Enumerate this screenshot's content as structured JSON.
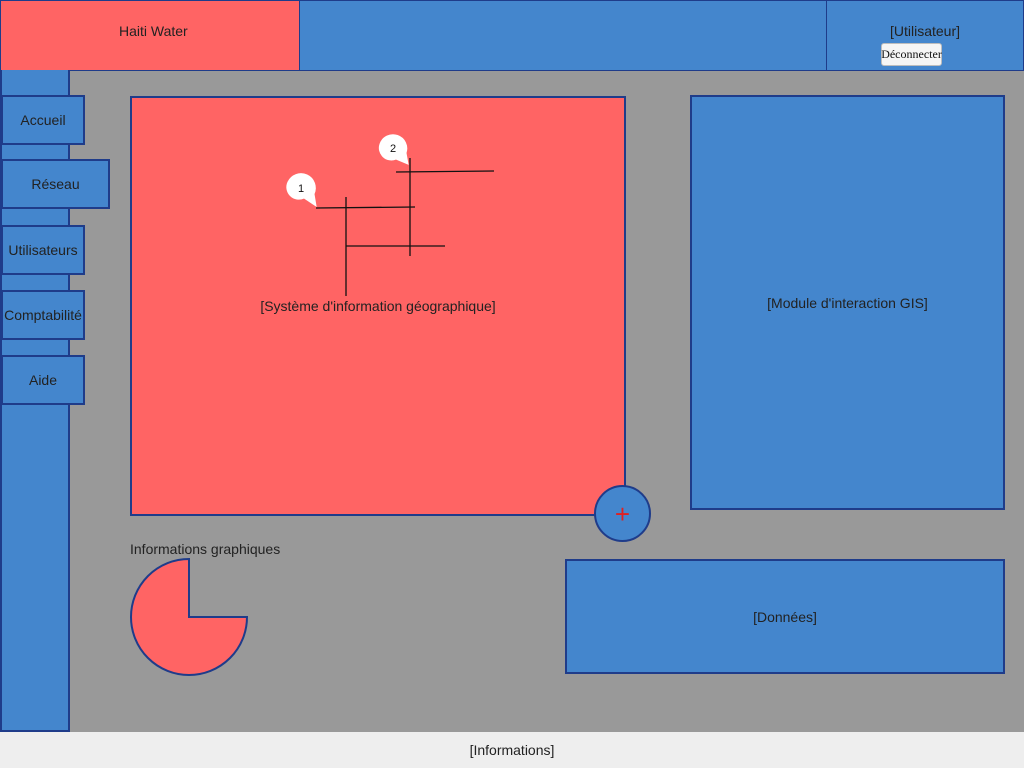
{
  "header": {
    "app_title": "Haiti Water",
    "user_label": "[Utilisateur]",
    "logout_label": "Déconnecter"
  },
  "sidebar": {
    "items": [
      {
        "label": "Accueil"
      },
      {
        "label": "Réseau"
      },
      {
        "label": "Utilisateurs"
      },
      {
        "label": "Comptabilité"
      },
      {
        "label": "Aide"
      }
    ]
  },
  "gis": {
    "label": "[Système d'information géographique]",
    "markers": [
      "1",
      "2"
    ]
  },
  "add_button": {
    "icon": "plus-icon",
    "label": "+"
  },
  "gis_module": {
    "label": "[Module d'interaction GIS]"
  },
  "data_panel": {
    "label": "[Données]"
  },
  "graphics": {
    "title": "Informations graphiques",
    "pie_icon": "pie-chart-icon"
  },
  "footer": {
    "label": "[Informations]"
  },
  "colors": {
    "accent_blue": "#4486CD",
    "accent_red": "#FF6464",
    "border": "#1F3C8A",
    "background": "#999999"
  }
}
